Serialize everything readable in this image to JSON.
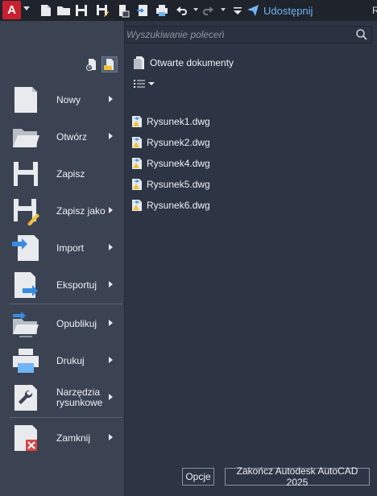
{
  "app": {
    "logo_letter": "A"
  },
  "toolbar": {
    "share_label": "Udostępnij",
    "edge_glyph": "R",
    "icons": [
      "new-icon",
      "open-icon",
      "save-icon",
      "save-as-icon",
      "open-web-icon",
      "save-web-icon",
      "plot-icon",
      "undo-icon",
      "redo-icon",
      "customize-icon",
      "share-icon"
    ]
  },
  "search": {
    "placeholder": "Wyszukiwanie poleceń"
  },
  "menu": {
    "items": [
      {
        "label": "Nowy",
        "has_submenu": true,
        "icon": "new-document-icon"
      },
      {
        "label": "Otwórz",
        "has_submenu": true,
        "icon": "open-folder-icon"
      },
      {
        "label": "Zapisz",
        "has_submenu": false,
        "icon": "save-disk-icon"
      },
      {
        "label": "Zapisz jako",
        "has_submenu": true,
        "icon": "save-as-disk-icon"
      },
      {
        "label": "Import",
        "has_submenu": true,
        "icon": "import-icon"
      },
      {
        "label": "Eksportuj",
        "has_submenu": true,
        "icon": "export-icon"
      },
      {
        "label": "Opublikuj",
        "has_submenu": true,
        "icon": "publish-icon"
      },
      {
        "label": "Drukuj",
        "has_submenu": true,
        "icon": "printer-icon"
      },
      {
        "label_line1": "Narzędzia",
        "label_line2": "rysunkowe",
        "has_submenu": true,
        "icon": "wrench-icon"
      },
      {
        "label": "Zamknij",
        "has_submenu": true,
        "icon": "close-document-icon"
      }
    ]
  },
  "open_documents": {
    "header": "Otwarte dokumenty",
    "files": [
      "Rysunek1.dwg",
      "Rysunek2.dwg",
      "Rysunek4.dwg",
      "Rysunek5.dwg",
      "Rysunek6.dwg"
    ]
  },
  "footer": {
    "options_label": "Opcje",
    "exit_label": "Zakończ Autodesk AutoCAD 2025"
  },
  "colors": {
    "accent_red": "#c8202f",
    "link_blue": "#6fb5f5",
    "panel_bg": "#3b4353",
    "doc_bg": "#2d3444"
  }
}
